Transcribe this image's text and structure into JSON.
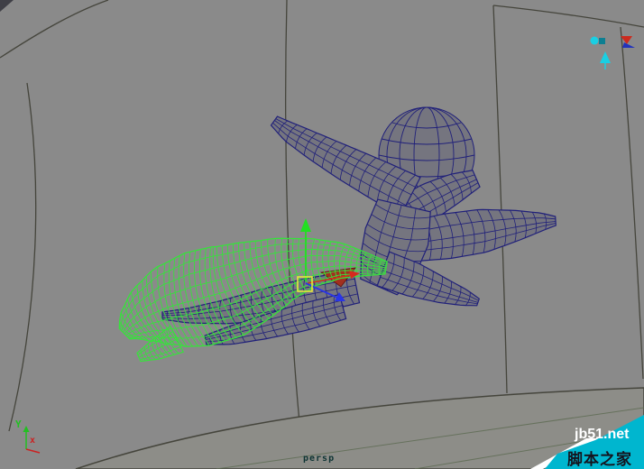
{
  "viewport": {
    "camera_label": "persp",
    "background_color": "#8a8a8a",
    "ground_color": "#8d8d88",
    "surface_line_color": "#45453c",
    "ground_line_color": "#5d6b52",
    "wireframe_color": "#20207a",
    "mesh_fill_color": "#75757f",
    "selected_wireframe_color": "#37e23c",
    "selected_face_color": "#a2301f",
    "label_color": "#0e3434"
  },
  "axis_indicator": {
    "y_label": "Y",
    "x_label": "x",
    "y_color": "#22c022",
    "x_color": "#cc2222"
  },
  "manipulator": {
    "y_color": "#22e022",
    "x_color": "#d42a1e",
    "z_color": "#2a35e6",
    "center_color": "#e6e63c"
  },
  "scene_icons": [
    {
      "name": "cyan-locator-icon"
    },
    {
      "name": "red-blue-arrows-icon"
    },
    {
      "name": "cyan-cone-icon"
    }
  ],
  "watermark": {
    "site": "jb51.net",
    "brand": "脚本之家",
    "band_color": "#00b6cf",
    "accent_color": "#ffffff",
    "site_text_color": "#ffffff",
    "brand_text_color": "#14141e"
  }
}
